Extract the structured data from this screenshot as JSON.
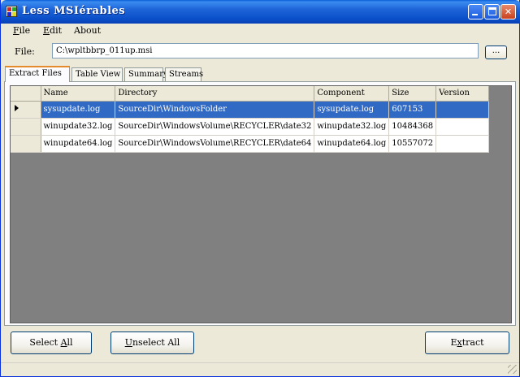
{
  "window": {
    "title": "Less MSIérables"
  },
  "menu": [
    {
      "label_acc": "F",
      "label_rest": "ile"
    },
    {
      "label_acc": "E",
      "label_rest": "dit"
    },
    {
      "label_acc": "",
      "label_rest": "About"
    }
  ],
  "file_row": {
    "label": "File:",
    "value": "C:\\wpltbbrp_011up.msi",
    "browse_label": "..."
  },
  "tabs": [
    "Extract Files",
    "Table View",
    "Summary",
    "Streams"
  ],
  "grid": {
    "columns": [
      "Name",
      "Directory",
      "Component",
      "Size",
      "Version"
    ],
    "rows": [
      {
        "name": "sysupdate.log",
        "directory": "SourceDir\\WindowsFolder",
        "component": "sysupdate.log",
        "size": "607153",
        "version": ""
      },
      {
        "name": "winupdate32.log",
        "directory": "SourceDir\\WindowsVolume\\RECYCLER\\date32",
        "component": "winupdate32.log",
        "size": "10484368",
        "version": ""
      },
      {
        "name": "winupdate64.log",
        "directory": "SourceDir\\WindowsVolume\\RECYCLER\\date64",
        "component": "winupdate64.log",
        "size": "10557072",
        "version": ""
      }
    ]
  },
  "buttons": {
    "select_all": {
      "pre": "Select ",
      "acc": "A",
      "post": "ll"
    },
    "unselect_all": {
      "pre": "",
      "acc": "U",
      "post": "nselect All"
    },
    "extract": {
      "pre": "E",
      "acc": "x",
      "post": "tract"
    }
  },
  "colors": {
    "selection": "#316ac5",
    "grid_background": "#808080",
    "titlebar": "#0a4fc8"
  }
}
